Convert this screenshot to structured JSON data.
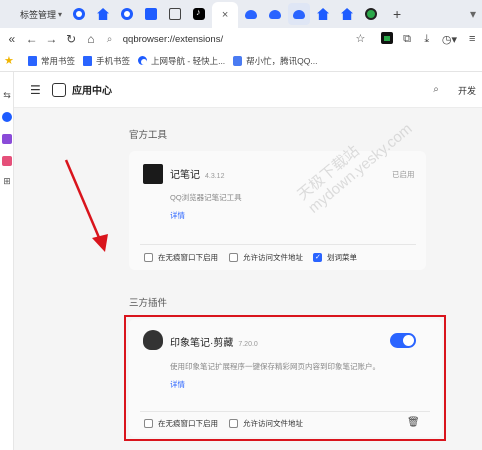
{
  "tabs": {
    "first_tab_title": "标签管理",
    "icons": [
      "qq-icon",
      "house-icon",
      "qq-icon",
      "book-icon",
      "film-icon",
      "tiktok-icon",
      "cloud-icon",
      "cloud-icon",
      "cloud-icon",
      "house-icon",
      "house-icon",
      "green-circle-icon"
    ],
    "active_close": "×",
    "new_tab": "+"
  },
  "toolbar": {
    "url": "qqbrowser://extensions/"
  },
  "bookmarks": [
    {
      "label": "常用书签"
    },
    {
      "label": "手机书签"
    },
    {
      "label": "上网导航 - 轻快上..."
    },
    {
      "label": "帮小忙，腾讯QQ..."
    }
  ],
  "app": {
    "title": "应用中心",
    "dev_mode": "开发"
  },
  "official": {
    "section": "官方工具",
    "name": "记笔记",
    "version": "4.3.12",
    "status": "已启用",
    "desc": "QQ浏览器记笔记工具",
    "details": "详情",
    "opt1": "在无痕窗口下启用",
    "opt2": "允许访问文件地址",
    "opt3": "划词菜单"
  },
  "third_party": {
    "section": "三方插件",
    "name": "印象笔记·剪藏",
    "version": "7.20.0",
    "desc": "使用印象笔记扩展程序一键保存精彩网页内容到印象笔记账户。",
    "details": "详情",
    "opt1": "在无痕窗口下启用",
    "opt2": "允许访问文件地址",
    "enabled": true
  },
  "watermark": {
    "line1": "天极下载站",
    "line2": "mydown.yesky.com"
  },
  "colors": {
    "accent": "#2a64ff",
    "annotation": "#d9141c"
  }
}
